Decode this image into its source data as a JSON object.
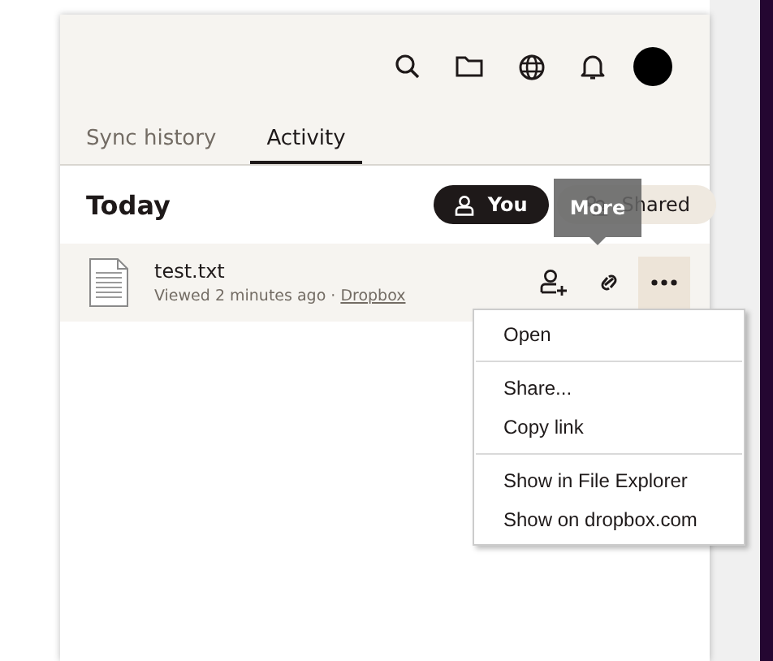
{
  "tabs": [
    {
      "label": "Sync history",
      "selected": false
    },
    {
      "label": "Activity",
      "selected": true
    }
  ],
  "section": {
    "title": "Today"
  },
  "filters": [
    {
      "label": "You",
      "selected": true,
      "kind": "single"
    },
    {
      "label": "Shared",
      "selected": false,
      "kind": "group"
    }
  ],
  "tooltip": {
    "text": "More"
  },
  "files": [
    {
      "name": "test.txt",
      "meta": "Viewed 2 minutes ago · ",
      "link": "Dropbox",
      "hovered": true
    }
  ],
  "menu": {
    "groups": [
      [
        "Open"
      ],
      [
        "Share...",
        "Copy link"
      ],
      [
        "Show in File Explorer",
        "Show on dropbox.com"
      ]
    ]
  }
}
